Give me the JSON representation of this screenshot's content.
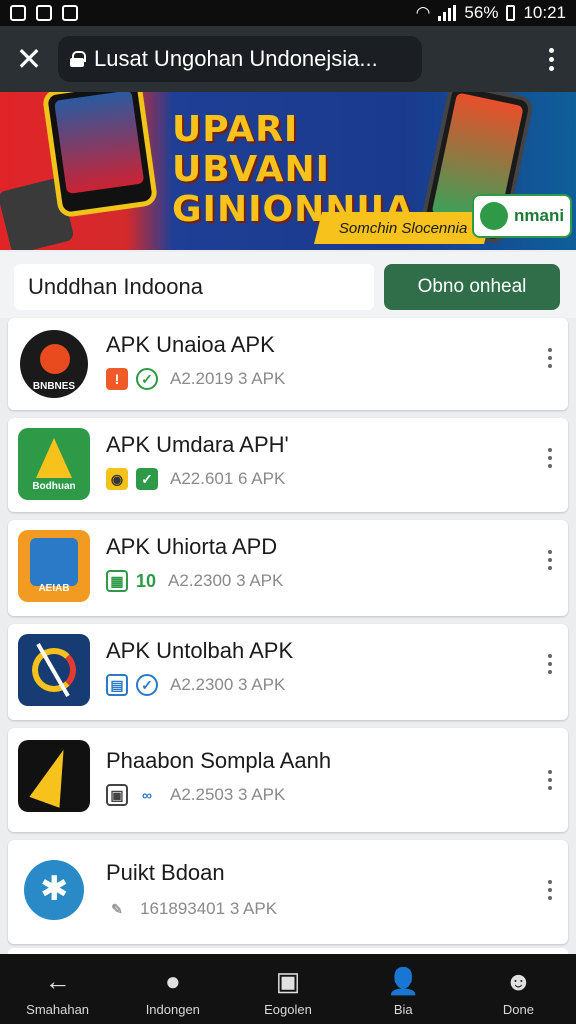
{
  "status_bar": {
    "battery": "56%",
    "time": "10:21"
  },
  "url_bar": {
    "title": "Lusat Ungohan Undonejsia..."
  },
  "banner": {
    "headline_line1": "UPARI UBVANI",
    "headline_line2": "GINIONNIIA",
    "ribbon": "Somchin Slocennia",
    "badge": "nmani"
  },
  "search": {
    "query": "Unddhan Indoona",
    "button_label": "Obno onheal"
  },
  "apps": [
    {
      "title": "APK Unaioa APK",
      "meta": "A2.2019 3 APK",
      "icon_label": "BNBNES",
      "icon_bg": "#ffffff",
      "meta_icons": [
        "warning-icon",
        "check-circle-icon"
      ]
    },
    {
      "title": "APK Umdara APH'",
      "meta": "A22.601 6 APK",
      "icon_label": "Bodhuan",
      "icon_bg": "#2e9a47",
      "meta_icons": [
        "badge-icon",
        "check-icon"
      ]
    },
    {
      "title": "APK Uhiorta APD",
      "meta": "A2.2300 3 APK",
      "icon_label": "AEIAB",
      "icon_bg": "#f39a22",
      "meta_icons": [
        "grid-icon",
        "number-icon"
      ],
      "meta_number": "10"
    },
    {
      "title": "APK Untolbah APK",
      "meta": "A2.2300 3 APK",
      "icon_label": "",
      "icon_bg": "#173b73",
      "meta_icons": [
        "grid-icon",
        "check-shield-icon"
      ]
    },
    {
      "title": "Phaabon Sompla Aanh",
      "meta": "A2.2503 3 APK",
      "icon_label": "",
      "icon_bg": "#ffffff",
      "meta_icons": [
        "box-icon",
        "link-icon"
      ]
    },
    {
      "title": "Puikt Bdoan",
      "meta": "161893401 3 APK",
      "icon_label": "",
      "icon_bg": "#ffffff",
      "meta_icons": [
        "pencil-icon"
      ]
    }
  ],
  "bottom_nav": [
    {
      "label": "Smahahan",
      "icon": "back-arrow-icon"
    },
    {
      "label": "Indongen",
      "icon": "ball-icon"
    },
    {
      "label": "Eogolen",
      "icon": "tablet-icon"
    },
    {
      "label": "Bia",
      "icon": "person-icon"
    },
    {
      "label": "Done",
      "icon": "person-alt-icon"
    }
  ]
}
